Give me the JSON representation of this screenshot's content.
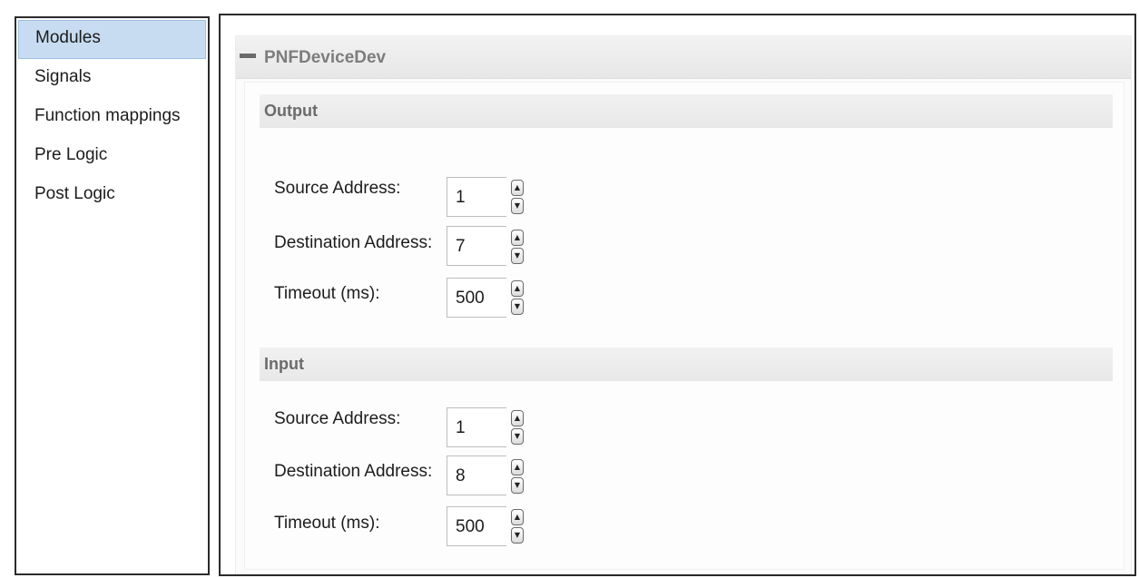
{
  "nav": {
    "items": [
      {
        "label": "Modules",
        "selected": true
      },
      {
        "label": "Signals",
        "selected": false
      },
      {
        "label": "Function mappings",
        "selected": false
      },
      {
        "label": "Pre Logic",
        "selected": false
      },
      {
        "label": "Post Logic",
        "selected": false
      }
    ]
  },
  "device": {
    "name": "PNFDeviceDev",
    "collapse_icon": "minus-icon"
  },
  "output": {
    "title": "Output",
    "source_label": "Source Address:",
    "source_value": "1",
    "destination_label": "Destination Address:",
    "destination_value": "7",
    "timeout_label": "Timeout (ms):",
    "timeout_value": "500"
  },
  "input": {
    "title": "Input",
    "source_label": "Source Address:",
    "source_value": "1",
    "destination_label": "Destination Address:",
    "destination_value": "8",
    "timeout_label": "Timeout (ms):",
    "timeout_value": "500"
  },
  "spinner": {
    "up_glyph": "▲",
    "down_glyph": "▼",
    "up_icon": "arrow-up-icon",
    "down_icon": "arrow-down-icon"
  },
  "colors": {
    "selected_bg": "#c7dcf0",
    "section_header_bg": "#e8e8e8",
    "border": "#2b2b2b"
  }
}
